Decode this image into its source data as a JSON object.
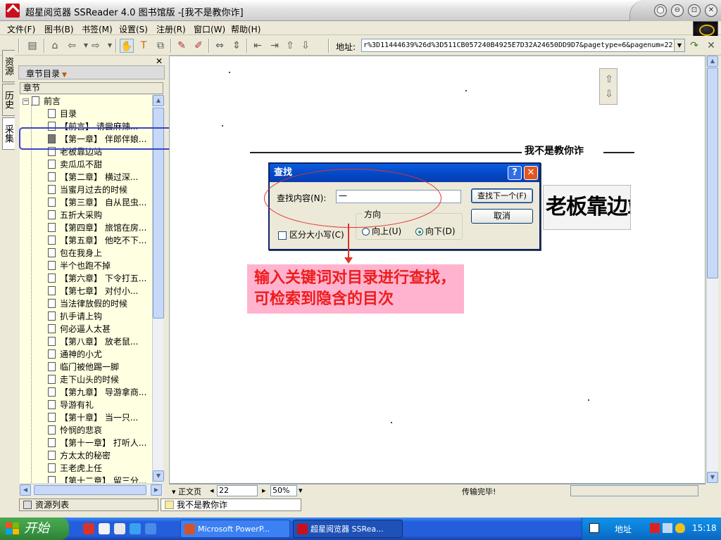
{
  "window": {
    "title": "超星阅览器 SSReader 4.0 图书馆版 -[我不是教你诈]"
  },
  "menu": [
    "文件(F)",
    "图书(B)",
    "书签(M)",
    "设置(S)",
    "注册(R)",
    "窗口(W)",
    "帮助(H)"
  ],
  "toolbar": {
    "address_label": "地址:",
    "address_value": "r%3D11444639%26d%3D511CB057240B4925E7D32A24650DD9D7&pagetype=6&pagenum=22"
  },
  "side_tabs": [
    "资源",
    "历史",
    "采集"
  ],
  "chapter_panel": {
    "title": "章节目录",
    "column_header": "章节",
    "root": "前言",
    "items": [
      "目录",
      "【前言】 请尝麻辣...",
      "【第一章】 伴郎伴娘...",
      "老板靠边站",
      "卖瓜瓜不甜",
      "【第二章】 横过深...",
      "当蜜月过去的时候",
      "【第三章】 自从昆虫...",
      "五折大采购",
      "【第四章】 旅馆在房...",
      "【第五章】 他吃不下...",
      "包在我身上",
      "半个也跑不掉",
      "【第六章】 下令打五...",
      "【第七章】 对付小...",
      "当法律放假的时候",
      "扒手请上钩",
      "何必逼人太甚",
      "【第八章】 放老鼠...",
      "通神的小尤",
      "临门被他踢一脚",
      "走下山头的时候",
      "【第九章】 导游拿商...",
      "导游有礼",
      "【第十章】 当一只...",
      "怜悯的悲哀",
      "【第十一章】 打听人...",
      "方太太的秘密",
      "王老虎上任",
      "【第十二章】 留三分..."
    ]
  },
  "bottom_tabs": {
    "resources": "资源列表",
    "document": "我不是教你诈"
  },
  "page": {
    "header_text": "我不是教你诈",
    "chapter_title": "老板靠边站"
  },
  "find_dialog": {
    "title": "查找",
    "help_glyph": "?",
    "close_glyph": "✕",
    "find_label": "查找内容(N):",
    "find_value": "一",
    "find_next": "查找下一个(F)",
    "cancel": "取消",
    "match_case": "区分大小写(C)",
    "direction_label": "方向",
    "up": "向上(U)",
    "down": "向下(D)"
  },
  "annotation": {
    "text": "输入关键词对目录进行查找，可检索到隐含的目次"
  },
  "statusbar": {
    "view": "正文页",
    "page": "22",
    "zoom": "50%",
    "status": "传输完毕!"
  },
  "taskbar": {
    "start": "开始",
    "tasks": [
      "Microsoft PowerP...",
      "超星阅览器 SSRea..."
    ],
    "address": "地址",
    "time": "15:18"
  }
}
